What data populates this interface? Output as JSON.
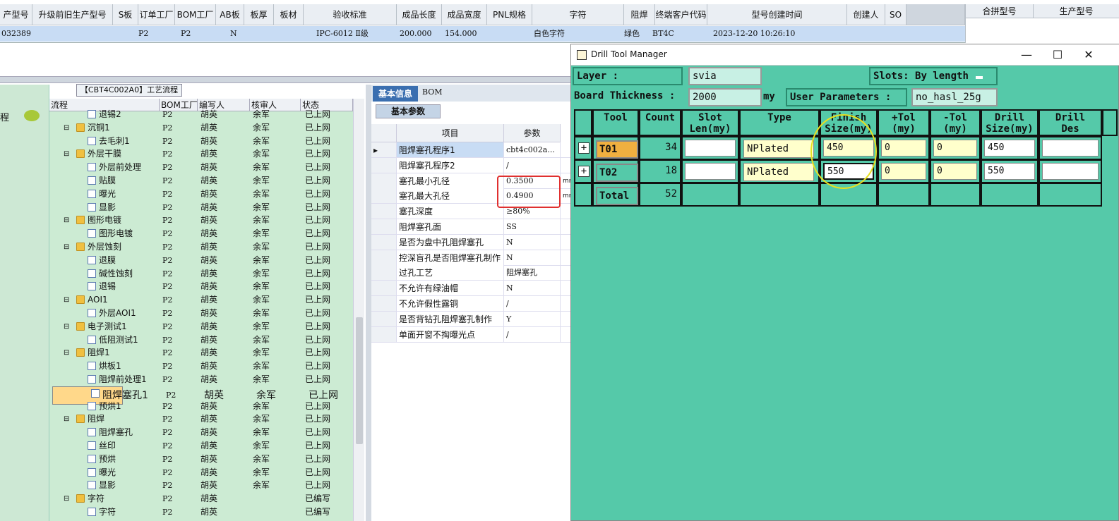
{
  "top_grid": {
    "headers": [
      "产型号",
      "升级前旧生产型号",
      "S板",
      "订单工厂",
      "BOM工厂",
      "AB板",
      "板厚",
      "板材",
      "验收标准",
      "成品长度",
      "成品宽度",
      "PNL规格",
      "字符",
      "阻焊",
      "终端客户代码",
      "型号创建时间",
      "创建人",
      "SO"
    ],
    "row": [
      "032389",
      "",
      "",
      "P2",
      "P2",
      "N",
      "",
      "",
      "IPC-6012 Ⅱ级",
      "200.000",
      "154.000",
      "",
      "白色字符",
      "绿色",
      "BT4C",
      "2023-12-20 10:26:10",
      "",
      ""
    ],
    "right_headers": [
      "合拼型号",
      "生产型号"
    ]
  },
  "left_panel": {
    "label": "程"
  },
  "flow": {
    "title": "【CBT4C002A0】工艺流程",
    "headers": [
      "流程",
      "BOM工厂",
      "编写人",
      "核审人",
      "状态"
    ],
    "rows": [
      {
        "name": "退锡2",
        "indent": 2,
        "icon": "doc",
        "bom": "P2",
        "writer": "胡英",
        "reviewer": "余军",
        "status": "已上网"
      },
      {
        "name": "沉铜1",
        "indent": 1,
        "icon": "folder",
        "bom": "P2",
        "writer": "胡英",
        "reviewer": "余军",
        "status": "已上网"
      },
      {
        "name": "去毛刺1",
        "indent": 2,
        "icon": "doc",
        "bom": "P2",
        "writer": "胡英",
        "reviewer": "余军",
        "status": "已上网"
      },
      {
        "name": "外层干膜",
        "indent": 1,
        "icon": "folder",
        "bom": "P2",
        "writer": "胡英",
        "reviewer": "余军",
        "status": "已上网"
      },
      {
        "name": "外层前处理",
        "indent": 2,
        "icon": "doc",
        "bom": "P2",
        "writer": "胡英",
        "reviewer": "余军",
        "status": "已上网"
      },
      {
        "name": "贴膜",
        "indent": 2,
        "icon": "doc",
        "bom": "P2",
        "writer": "胡英",
        "reviewer": "余军",
        "status": "已上网"
      },
      {
        "name": "曝光",
        "indent": 2,
        "icon": "doc",
        "bom": "P2",
        "writer": "胡英",
        "reviewer": "余军",
        "status": "已上网"
      },
      {
        "name": "显影",
        "indent": 2,
        "icon": "doc",
        "bom": "P2",
        "writer": "胡英",
        "reviewer": "余军",
        "status": "已上网"
      },
      {
        "name": "图形电镀",
        "indent": 1,
        "icon": "folder",
        "bom": "P2",
        "writer": "胡英",
        "reviewer": "余军",
        "status": "已上网"
      },
      {
        "name": "图形电镀",
        "indent": 2,
        "icon": "doc",
        "bom": "P2",
        "writer": "胡英",
        "reviewer": "余军",
        "status": "已上网"
      },
      {
        "name": "外层蚀刻",
        "indent": 1,
        "icon": "folder",
        "bom": "P2",
        "writer": "胡英",
        "reviewer": "余军",
        "status": "已上网"
      },
      {
        "name": "退膜",
        "indent": 2,
        "icon": "doc",
        "bom": "P2",
        "writer": "胡英",
        "reviewer": "余军",
        "status": "已上网"
      },
      {
        "name": "碱性蚀刻",
        "indent": 2,
        "icon": "doc",
        "bom": "P2",
        "writer": "胡英",
        "reviewer": "余军",
        "status": "已上网"
      },
      {
        "name": "退锡",
        "indent": 2,
        "icon": "doc",
        "bom": "P2",
        "writer": "胡英",
        "reviewer": "余军",
        "status": "已上网"
      },
      {
        "name": "AOI1",
        "indent": 1,
        "icon": "folder",
        "bom": "P2",
        "writer": "胡英",
        "reviewer": "余军",
        "status": "已上网"
      },
      {
        "name": "外层AOI1",
        "indent": 2,
        "icon": "doc",
        "bom": "P2",
        "writer": "胡英",
        "reviewer": "余军",
        "status": "已上网"
      },
      {
        "name": "电子测试1",
        "indent": 1,
        "icon": "folder",
        "bom": "P2",
        "writer": "胡英",
        "reviewer": "余军",
        "status": "已上网"
      },
      {
        "name": "低阻测试1",
        "indent": 2,
        "icon": "doc",
        "bom": "P2",
        "writer": "胡英",
        "reviewer": "余军",
        "status": "已上网"
      },
      {
        "name": "阻焊1",
        "indent": 1,
        "icon": "folder",
        "bom": "P2",
        "writer": "胡英",
        "reviewer": "余军",
        "status": "已上网"
      },
      {
        "name": "烘板1",
        "indent": 2,
        "icon": "doc",
        "bom": "P2",
        "writer": "胡英",
        "reviewer": "余军",
        "status": "已上网"
      },
      {
        "name": "阻焊前处理1",
        "indent": 2,
        "icon": "doc",
        "bom": "P2",
        "writer": "胡英",
        "reviewer": "余军",
        "status": "已上网"
      },
      {
        "name": "阻焊塞孔1",
        "indent": 2,
        "icon": "doc",
        "bom": "P2",
        "writer": "胡英",
        "reviewer": "余军",
        "status": "已上网",
        "selected": true
      },
      {
        "name": "预烘1",
        "indent": 2,
        "icon": "doc",
        "bom": "P2",
        "writer": "胡英",
        "reviewer": "余军",
        "status": "已上网"
      },
      {
        "name": "阻焊",
        "indent": 1,
        "icon": "folder",
        "bom": "P2",
        "writer": "胡英",
        "reviewer": "余军",
        "status": "已上网"
      },
      {
        "name": "阻焊塞孔",
        "indent": 2,
        "icon": "doc",
        "bom": "P2",
        "writer": "胡英",
        "reviewer": "余军",
        "status": "已上网"
      },
      {
        "name": "丝印",
        "indent": 2,
        "icon": "doc",
        "bom": "P2",
        "writer": "胡英",
        "reviewer": "余军",
        "status": "已上网"
      },
      {
        "name": "预烘",
        "indent": 2,
        "icon": "doc",
        "bom": "P2",
        "writer": "胡英",
        "reviewer": "余军",
        "status": "已上网"
      },
      {
        "name": "曝光",
        "indent": 2,
        "icon": "doc",
        "bom": "P2",
        "writer": "胡英",
        "reviewer": "余军",
        "status": "已上网"
      },
      {
        "name": "显影",
        "indent": 2,
        "icon": "doc",
        "bom": "P2",
        "writer": "胡英",
        "reviewer": "余军",
        "status": "已上网"
      },
      {
        "name": "字符",
        "indent": 1,
        "icon": "folder",
        "bom": "P2",
        "writer": "胡英",
        "reviewer": "",
        "status": "已编写"
      },
      {
        "name": "字符",
        "indent": 2,
        "icon": "doc",
        "bom": "P2",
        "writer": "胡英",
        "reviewer": "",
        "status": "已编写"
      }
    ]
  },
  "mid_panel": {
    "tab_basic": "基本信息",
    "tab_bom": "BOM",
    "subtab": "基本参数",
    "headers": [
      "项目",
      "参数"
    ],
    "rows": [
      {
        "item": "阻焊塞孔程序1",
        "value": "cbt4c002a...",
        "unit": ""
      },
      {
        "item": "阻焊塞孔程序2",
        "value": "/",
        "unit": ""
      },
      {
        "item": "塞孔最小孔径",
        "value": "0.3500",
        "unit": "mm"
      },
      {
        "item": "塞孔最大孔径",
        "value": "0.4900",
        "unit": "mm"
      },
      {
        "item": "塞孔深度",
        "value": "≥80%",
        "unit": ""
      },
      {
        "item": "阻焊塞孔面",
        "value": "SS",
        "unit": ""
      },
      {
        "item": "是否为盘中孔阻焊塞孔",
        "value": "N",
        "unit": ""
      },
      {
        "item": "控深盲孔是否阻焊塞孔制作",
        "value": "N",
        "unit": ""
      },
      {
        "item": "过孔工艺",
        "value": "阻焊塞孔",
        "unit": ""
      },
      {
        "item": "不允许有绿油帽",
        "value": "N",
        "unit": ""
      },
      {
        "item": "不允许假性露铜",
        "value": "/",
        "unit": ""
      },
      {
        "item": "是否背钻孔阻焊塞孔制作",
        "value": "Y",
        "unit": ""
      },
      {
        "item": "单面开窗不掏曝光点",
        "value": "/",
        "unit": ""
      }
    ]
  },
  "drill": {
    "title": "Drill Tool Manager",
    "layer_label": "Layer :",
    "layer_value": "svia",
    "slots_label": "Slots:",
    "slots_value": "By length",
    "thickness_label": "Board Thickness :",
    "thickness_value": "2000",
    "thickness_unit": "my",
    "userparam_label": "User Parameters :",
    "userparam_value": "no_hasl_25g",
    "headers": [
      "",
      "Tool",
      "Count",
      "Slot\nLen(my)",
      "Type",
      "Finish\nSize(my)",
      "+Tol\n(my)",
      "-Tol\n(my)",
      "Drill\nSize(my)",
      "Drill\nDes"
    ],
    "tools": [
      {
        "tool": "T01",
        "count": "34",
        "slot": "",
        "type": "NPlated",
        "finish": "450",
        "ptol": "0",
        "ntol": "0",
        "drill": "450",
        "des": ""
      },
      {
        "tool": "T02",
        "count": "18",
        "slot": "",
        "type": "NPlated",
        "finish": "550",
        "ptol": "0",
        "ntol": "0",
        "drill": "550",
        "des": ""
      }
    ],
    "total_label": "Total",
    "total_count": "52"
  }
}
